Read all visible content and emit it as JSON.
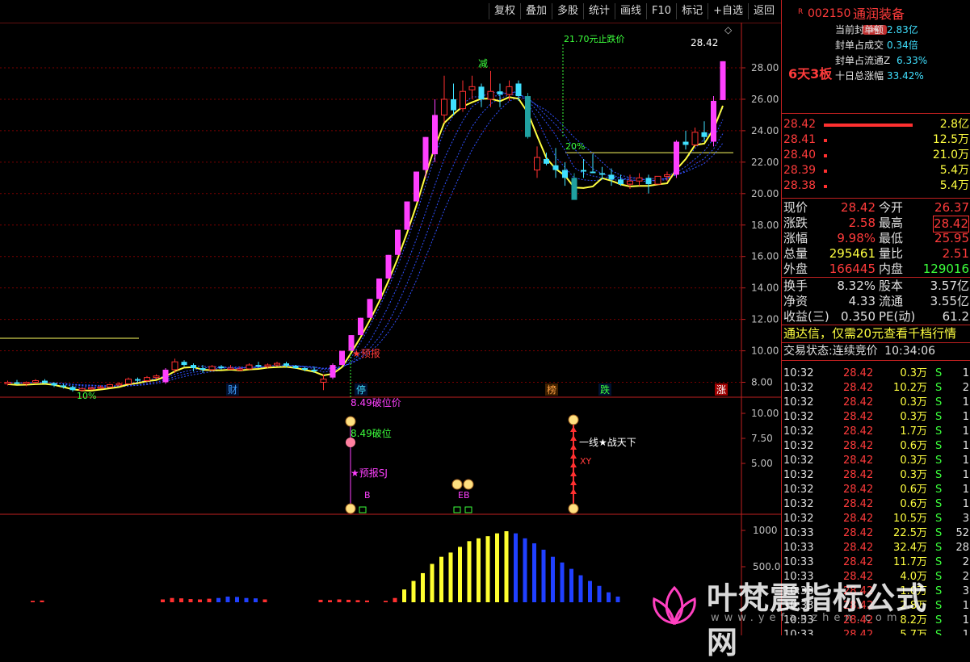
{
  "toolbar": {
    "items": [
      "复权",
      "叠加",
      "多股",
      "统计",
      "画线",
      "F10",
      "标记",
      "+自选",
      "返回"
    ]
  },
  "stock": {
    "code": "002150",
    "name": "通润装备",
    "badge": "R"
  },
  "limit": {
    "streak": "6天3板",
    "rows": [
      {
        "label": "当前封单额",
        "value": "2.83亿"
      },
      {
        "label": "封单占成交",
        "value": "0.34倍"
      },
      {
        "label": "封单占流通Z",
        "value": "6.33%"
      },
      {
        "label": "十日总涨幅",
        "value": "33.42%"
      }
    ]
  },
  "orderbook": [
    {
      "price": "28.42",
      "vol": "2.8亿"
    },
    {
      "price": "28.41",
      "vol": "12.5万"
    },
    {
      "price": "28.40",
      "vol": "21.0万"
    },
    {
      "price": "28.39",
      "vol": "5.4万"
    },
    {
      "price": "28.38",
      "vol": "5.4万"
    }
  ],
  "quote": [
    {
      "l1": "现价",
      "v1": "28.42",
      "l2": "今开",
      "v2": "26.37"
    },
    {
      "l1": "涨跌",
      "v1": "2.58",
      "l2": "最高",
      "v2": "28.42"
    },
    {
      "l1": "涨幅",
      "v1": "9.98%",
      "l2": "最低",
      "v2": "25.95"
    },
    {
      "l1": "总量",
      "v1": "295461",
      "l2": "量比",
      "v2": "2.51"
    },
    {
      "l1": "外盘",
      "v1": "166445",
      "l2": "内盘",
      "v2": "129016"
    }
  ],
  "fin": [
    {
      "l1": "换手",
      "v1": "8.32%",
      "l2": "股本",
      "v2": "3.57亿"
    },
    {
      "l1": "净资",
      "v1": "4.33",
      "l2": "流通",
      "v2": "3.55亿"
    },
    {
      "l1": "收益(三)",
      "v1": "0.350",
      "l2": "PE(动)",
      "v2": "61.2"
    }
  ],
  "promo": "通达信，仅需20元查看千档行情",
  "trade_status": {
    "label": "交易状态:",
    "state": "连续竞价",
    "time": "10:34:06"
  },
  "ticks": [
    {
      "t": "10:32",
      "p": "28.42",
      "v": "0.3万",
      "s": "S",
      "n": "1"
    },
    {
      "t": "10:32",
      "p": "28.42",
      "v": "10.2万",
      "s": "S",
      "n": "2"
    },
    {
      "t": "10:32",
      "p": "28.42",
      "v": "0.3万",
      "s": "S",
      "n": "1"
    },
    {
      "t": "10:32",
      "p": "28.42",
      "v": "0.3万",
      "s": "S",
      "n": "1"
    },
    {
      "t": "10:32",
      "p": "28.42",
      "v": "1.7万",
      "s": "S",
      "n": "1"
    },
    {
      "t": "10:32",
      "p": "28.42",
      "v": "0.6万",
      "s": "S",
      "n": "1"
    },
    {
      "t": "10:32",
      "p": "28.42",
      "v": "0.3万",
      "s": "S",
      "n": "1"
    },
    {
      "t": "10:32",
      "p": "28.42",
      "v": "0.3万",
      "s": "S",
      "n": "1"
    },
    {
      "t": "10:32",
      "p": "28.42",
      "v": "0.6万",
      "s": "S",
      "n": "1"
    },
    {
      "t": "10:32",
      "p": "28.42",
      "v": "0.6万",
      "s": "S",
      "n": "1"
    },
    {
      "t": "10:32",
      "p": "28.42",
      "v": "10.5万",
      "s": "S",
      "n": "3"
    },
    {
      "t": "10:33",
      "p": "28.42",
      "v": "22.5万",
      "s": "S",
      "n": "52"
    },
    {
      "t": "10:33",
      "p": "28.42",
      "v": "32.4万",
      "s": "S",
      "n": "28"
    },
    {
      "t": "10:33",
      "p": "28.42",
      "v": "11.7万",
      "s": "S",
      "n": "2"
    },
    {
      "t": "10:33",
      "p": "28.42",
      "v": "4.0万",
      "s": "S",
      "n": "2"
    },
    {
      "t": "10:33",
      "p": "28.42",
      "v": "1.0万",
      "s": "S",
      "n": "3"
    },
    {
      "t": "10:33",
      "p": "28.42",
      "v": "2.8万",
      "s": "S",
      "n": "1"
    },
    {
      "t": "10:33",
      "p": "28.42",
      "v": "8.2万",
      "s": "S",
      "n": "1"
    },
    {
      "t": "10:33",
      "p": "28.42",
      "v": "5.7万",
      "s": "S",
      "n": "1"
    }
  ],
  "axis": {
    "main": [
      "28.00",
      "26.00",
      "24.00",
      "22.00",
      "20.00",
      "18.00",
      "16.00",
      "14.00",
      "12.00",
      "10.00",
      "8.00"
    ],
    "mid": [
      "10.00",
      "7.50",
      "5.00"
    ],
    "vol": [
      "1000",
      "500.0"
    ]
  },
  "chart_data": {
    "type": "candlestick",
    "ohlc": [
      [
        7.9,
        8.1,
        7.8,
        8.0
      ],
      [
        8.0,
        8.15,
        7.85,
        7.9
      ],
      [
        7.9,
        8.05,
        7.75,
        8.0
      ],
      [
        8.0,
        8.2,
        7.9,
        8.1
      ],
      [
        8.1,
        8.2,
        7.9,
        7.95
      ],
      [
        7.95,
        8.0,
        7.7,
        7.8
      ],
      [
        7.8,
        7.9,
        7.6,
        7.7
      ],
      [
        7.7,
        7.8,
        7.4,
        7.5
      ],
      [
        7.5,
        7.65,
        7.4,
        7.6
      ],
      [
        7.6,
        7.7,
        7.5,
        7.65
      ],
      [
        7.65,
        7.8,
        7.6,
        7.7
      ],
      [
        7.7,
        7.9,
        7.65,
        7.85
      ],
      [
        7.85,
        8.0,
        7.8,
        7.9
      ],
      [
        7.9,
        8.3,
        7.85,
        8.2
      ],
      [
        8.2,
        8.3,
        8.0,
        8.1
      ],
      [
        8.1,
        8.4,
        8.0,
        8.3
      ],
      [
        8.3,
        8.5,
        8.2,
        8.4
      ],
      [
        8.0,
        8.9,
        7.9,
        8.8
      ],
      [
        8.8,
        9.5,
        8.6,
        9.3
      ],
      [
        9.3,
        9.4,
        9.0,
        9.1
      ],
      [
        9.1,
        9.2,
        8.7,
        8.9
      ],
      [
        8.9,
        9.1,
        8.6,
        8.8
      ],
      [
        8.8,
        9.1,
        8.7,
        9.0
      ],
      [
        9.0,
        9.1,
        8.8,
        8.9
      ],
      [
        8.9,
        9.1,
        8.8,
        8.9
      ],
      [
        8.8,
        9.0,
        8.7,
        8.85
      ],
      [
        8.85,
        9.2,
        8.8,
        9.1
      ],
      [
        9.1,
        9.3,
        8.95,
        9.0
      ],
      [
        9.0,
        9.2,
        8.9,
        9.1
      ],
      [
        9.1,
        9.3,
        9.0,
        9.2
      ],
      [
        9.2,
        9.3,
        8.95,
        9.05
      ],
      [
        9.05,
        9.1,
        8.85,
        8.9
      ],
      [
        8.9,
        9.0,
        8.7,
        8.8
      ],
      [
        8.8,
        9.0,
        8.6,
        8.7
      ],
      [
        8.0,
        8.49,
        7.5,
        8.2
      ],
      [
        8.3,
        9.2,
        8.2,
        9.1
      ],
      [
        9.1,
        10.0,
        9.1,
        10.0
      ],
      [
        10.0,
        11.0,
        10.0,
        11.0
      ],
      [
        11.0,
        12.1,
        11.0,
        12.1
      ],
      [
        12.1,
        13.3,
        12.1,
        13.3
      ],
      [
        13.3,
        14.6,
        13.3,
        14.6
      ],
      [
        14.6,
        16.1,
        14.6,
        16.1
      ],
      [
        16.1,
        17.7,
        16.1,
        17.7
      ],
      [
        17.7,
        19.5,
        17.7,
        19.5
      ],
      [
        19.5,
        21.4,
        19.5,
        21.4
      ],
      [
        21.5,
        23.6,
        21.0,
        23.6
      ],
      [
        22.5,
        26.0,
        22.0,
        25.0
      ],
      [
        25.0,
        27.5,
        24.5,
        26.0
      ],
      [
        26.0,
        27.0,
        25.0,
        25.3
      ],
      [
        25.4,
        27.2,
        25.2,
        26.5
      ],
      [
        26.6,
        27.5,
        26.0,
        26.8
      ],
      [
        26.8,
        27.0,
        25.5,
        26.0
      ],
      [
        26.0,
        27.8,
        25.5,
        26.5
      ],
      [
        26.5,
        27.0,
        25.5,
        26.3
      ],
      [
        26.3,
        27.2,
        25.9,
        26.8
      ],
      [
        27.0,
        27.2,
        25.9,
        26.2
      ],
      [
        26.2,
        26.4,
        23.5,
        23.6
      ],
      [
        21.5,
        23.0,
        21.0,
        22.3
      ],
      [
        22.2,
        22.6,
        21.8,
        21.9
      ],
      [
        21.8,
        22.9,
        21.0,
        21.5
      ],
      [
        21.5,
        22.0,
        20.5,
        21.0
      ],
      [
        21.0,
        21.3,
        20.0,
        19.6
      ],
      [
        21.5,
        22.2,
        21.0,
        21.4
      ],
      [
        21.4,
        22.5,
        21.3,
        21.3
      ],
      [
        21.3,
        21.7,
        20.9,
        21.2
      ],
      [
        21.2,
        21.6,
        20.5,
        20.9
      ],
      [
        20.9,
        21.2,
        20.5,
        20.6
      ],
      [
        20.6,
        21.2,
        20.3,
        20.8
      ],
      [
        20.8,
        21.3,
        20.5,
        21.0
      ],
      [
        21.0,
        21.2,
        20.0,
        20.6
      ],
      [
        20.6,
        21.1,
        20.6,
        21.1
      ],
      [
        21.1,
        21.4,
        20.8,
        21.2
      ],
      [
        21.2,
        23.4,
        21.0,
        23.3
      ],
      [
        23.3,
        24.0,
        22.8,
        23.1
      ],
      [
        23.1,
        24.2,
        23.0,
        23.9
      ],
      [
        23.9,
        24.6,
        23.3,
        23.6
      ],
      [
        23.3,
        26.2,
        23.0,
        25.9
      ],
      [
        25.95,
        28.42,
        25.95,
        28.42
      ]
    ],
    "volume": [
      20,
      25,
      0,
      0,
      0,
      0,
      0,
      0,
      0,
      0,
      0,
      0,
      0,
      0,
      40,
      60,
      55,
      45,
      40,
      50,
      60,
      80,
      75,
      60,
      55,
      40,
      0,
      0,
      0,
      0,
      0,
      35,
      30,
      40,
      35,
      30,
      25,
      0,
      20,
      60,
      180,
      300,
      410,
      540,
      640,
      700,
      780,
      860,
      900,
      930,
      970,
      1000,
      970,
      900,
      830,
      740,
      640,
      560,
      470,
      380,
      300,
      230,
      140,
      80
    ],
    "ylim": [
      7,
      29
    ],
    "labels": {
      "last": "28.42",
      "target": "21.70元止跌价",
      "pre": "★预报",
      "breakline": "8.49破位价",
      "pct10": "10%",
      "pct20": "20%",
      "reduce": "减",
      "one_line": "一线★战天下",
      "xy": "XY",
      "yubao_sj": "★预报SJ",
      "break_mid": "8.49破位",
      "b": "B",
      "eb": "EB"
    },
    "events": [
      "财",
      "停",
      "榜",
      "跌",
      "涨"
    ]
  },
  "watermark": {
    "title": "叶梵震指标公式网",
    "url": "www.yefanzhen.com"
  }
}
